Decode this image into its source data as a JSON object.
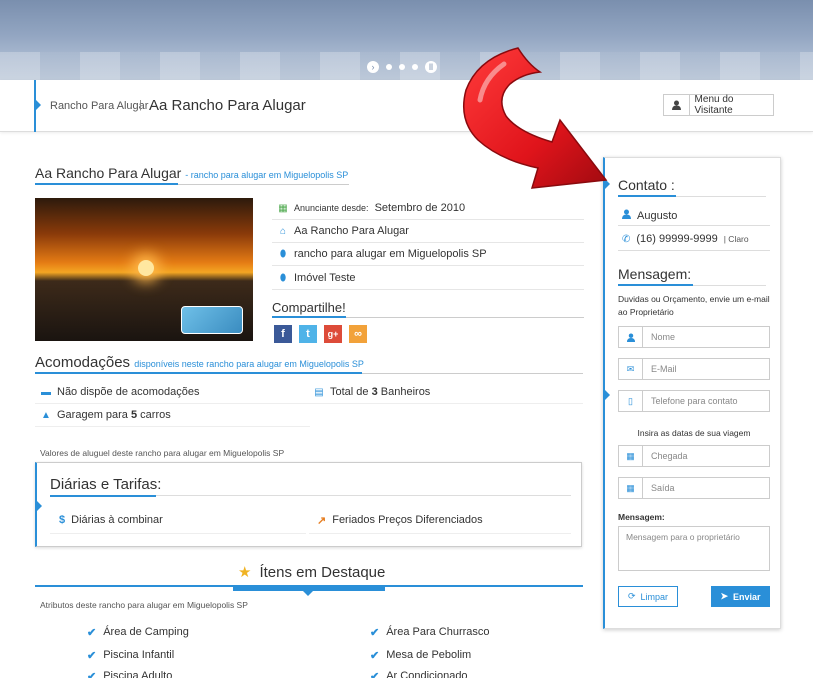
{
  "slider": {
    "count": 4
  },
  "header": {
    "breadcrumb": "Rancho Para Alugar",
    "separator": "|",
    "title": "Aa Rancho Para Alugar",
    "visitor_menu": "Menu do Visitante"
  },
  "listing": {
    "name": "Aa Rancho Para Alugar",
    "subtitle": "- rancho para alugar em Miguelopolis SP",
    "advertiser_label": "Anunciante desde:",
    "advertiser_since": "Setembro de 2010",
    "rows": [
      "Aa Rancho Para Alugar",
      "rancho para alugar em Miguelopolis SP",
      "Imóvel Teste"
    ],
    "share_title": "Compartilhe!"
  },
  "accommodations": {
    "title": "Acomodações",
    "subtitle": "disponíveis neste rancho para alugar em Miguelopolis SP",
    "no_rooms": "Não dispõe de acomodações",
    "bath_prefix": "Total de ",
    "bath_count": "3",
    "bath_suffix": " Banheiros",
    "garage_prefix": "Garagem para ",
    "garage_count": "5",
    "garage_suffix": " carros"
  },
  "rates": {
    "note": "Valores de aluguel deste rancho para alugar em Miguelopolis SP",
    "title": "Diárias e Tarifas:",
    "daily": "Diárias à combinar",
    "holidays": "Feriados Preços Diferenciados"
  },
  "featured": {
    "title": "Ítens em Destaque",
    "note": "Atributos deste rancho para alugar em Miguelopolis SP",
    "left": [
      "Área de Camping",
      "Piscina Infantil",
      "Piscina Adulto"
    ],
    "right": [
      "Área Para Churrasco",
      "Mesa de Pebolim",
      "Ar Condicionado"
    ]
  },
  "contact": {
    "title": "Contato :",
    "name": "Augusto",
    "phone": "(16) 99999-9999",
    "carrier": "| Claro",
    "message_title": "Mensagem:",
    "message_desc": "Duvidas ou Orçamento, envie um e-mail ao Proprietário",
    "placeholders": {
      "name": "Nome",
      "email": "E-Mail",
      "phone": "Telefone para contato",
      "arrival": "Chegada",
      "departure": "Saída",
      "message": "Mensagem para o proprietário"
    },
    "dates_label": "Insira as datas de sua viagem",
    "message_label": "Mensagem:",
    "clear_button": "Limpar",
    "send_button": "Enviar"
  },
  "colors": {
    "accent": "#2a8fd8",
    "arrow": "#e0141b"
  },
  "icons": [
    "user-icon",
    "calendar-icon",
    "home-icon",
    "map-marker-icon",
    "phone-icon",
    "envelope-icon",
    "mobile-icon",
    "bus-icon",
    "road-icon",
    "bath-icon",
    "dollar-icon",
    "share-icon",
    "star-icon",
    "check-icon",
    "refresh-icon",
    "send-icon"
  ]
}
